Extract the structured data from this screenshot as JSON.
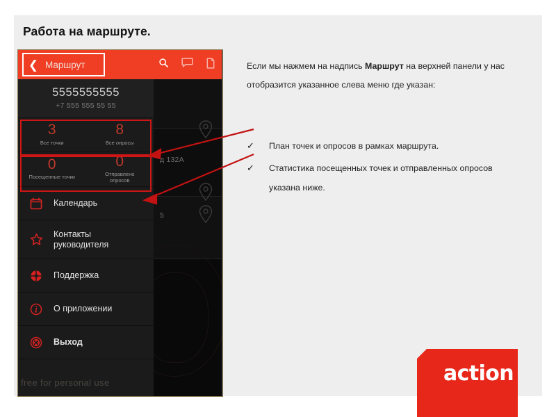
{
  "slide": {
    "title": "Работа на маршруте.",
    "background_color": "#eeeeee",
    "accent_color": "#ef3e23",
    "highlight_color": "#cf1616"
  },
  "phone": {
    "appbar": {
      "back_label": "Маршрут",
      "back_icon": "chevron-left-icon",
      "icons": [
        "search-icon",
        "chat-icon",
        "document-icon"
      ]
    },
    "drawer": {
      "account": {
        "phone_primary": "5555555555",
        "phone_secondary": "+7 555 555 55 55"
      },
      "stats": [
        {
          "highlighted": true,
          "cells": [
            {
              "value": "3",
              "label": "Все точки"
            },
            {
              "value": "8",
              "label": "Все опросы"
            }
          ]
        },
        {
          "highlighted": true,
          "cells": [
            {
              "value": "0",
              "label": "Посещенные точки"
            },
            {
              "value": "0",
              "label": "Отправлено опросов"
            }
          ]
        }
      ],
      "menu": [
        {
          "label": "Календарь",
          "icon": "calendar-icon"
        },
        {
          "label": "Контакты руководителя",
          "icon": "star-icon"
        },
        {
          "label": "Поддержка",
          "icon": "support-icon"
        },
        {
          "label": "О приложении",
          "icon": "info-icon"
        },
        {
          "label": "Выход",
          "icon": "exit-icon"
        }
      ]
    },
    "map": {
      "labels": [
        "д 132А",
        "5"
      ],
      "pin_icon": "map-pin-icon"
    },
    "watermark": "free for personal use"
  },
  "content": {
    "paragraph_before": "Если мы нажмем на надпись ",
    "paragraph_bold": "Маршрут",
    "paragraph_after": " на верхней панели у нас отобразится указанное слева меню где указан:",
    "bullets": [
      {
        "marker": "✓",
        "text": "План точек и опросов в рамках маршрута."
      },
      {
        "marker": "✓",
        "text": "Статистика посещенных точек и отправленных опросов указана ниже."
      }
    ]
  },
  "logo": {
    "text": "action",
    "color": "#e8271b"
  }
}
